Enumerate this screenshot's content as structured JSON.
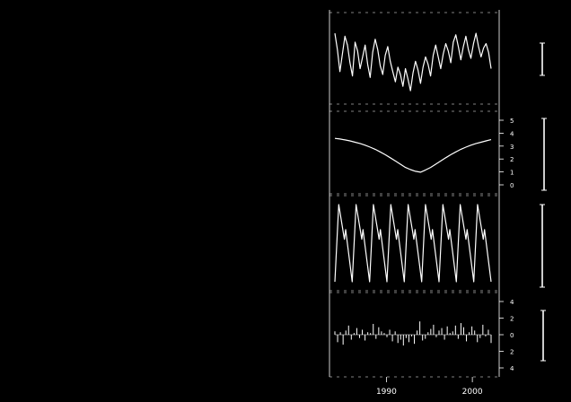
{
  "colors": {
    "background": "#000000",
    "foreground": "#ffffff"
  },
  "chart_data": {
    "type": "line",
    "panels": [
      {
        "kind": "line",
        "y": [
          4.2,
          3.1,
          1.6,
          2.8,
          4.0,
          3.4,
          2.2,
          1.3,
          3.6,
          3.0,
          1.8,
          2.6,
          3.4,
          2.1,
          1.2,
          2.9,
          3.8,
          3.1,
          2.0,
          1.4,
          2.7,
          3.3,
          2.3,
          1.6,
          0.9,
          1.9,
          1.4,
          0.6,
          1.8,
          1.1,
          0.3,
          1.5,
          2.3,
          1.7,
          0.8,
          1.9,
          2.6,
          2.1,
          1.3,
          2.7,
          3.4,
          2.6,
          1.8,
          2.8,
          3.5,
          3.0,
          2.2,
          3.6,
          4.1,
          3.3,
          2.4,
          3.3,
          4.0,
          3.1,
          2.5,
          3.5,
          4.2,
          3.3,
          2.6,
          3.2,
          3.5,
          2.9,
          1.8
        ],
        "ylim": [
          0,
          5
        ],
        "yticks": [],
        "ytick_labels": []
      },
      {
        "kind": "line",
        "y": [
          3.6,
          3.55,
          3.48,
          3.4,
          3.3,
          3.2,
          3.07,
          2.92,
          2.75,
          2.55,
          2.33,
          2.1,
          1.85,
          1.6,
          1.35,
          1.18,
          1.05,
          0.98,
          1.15,
          1.35,
          1.6,
          1.85,
          2.1,
          2.33,
          2.55,
          2.75,
          2.92,
          3.07,
          3.2,
          3.3,
          3.4,
          3.5
        ],
        "ylim": [
          0,
          5
        ],
        "yticks": [
          5,
          4,
          3,
          2,
          1,
          0
        ],
        "ytick_labels": [
          "5",
          "4",
          "3",
          "2",
          "1",
          "0"
        ]
      },
      {
        "kind": "seasonal",
        "periods": 9,
        "ylim": [
          -1,
          1
        ],
        "yticks": [],
        "ytick_labels": []
      },
      {
        "kind": "spikes",
        "y": [
          0.4,
          -0.9,
          0.3,
          -1.2,
          0.5,
          1.1,
          -0.6,
          0.2,
          0.8,
          -0.4,
          0.6,
          -0.7,
          0.3,
          0.2,
          1.3,
          -0.5,
          0.9,
          0.4,
          0.2,
          -0.3,
          0.6,
          -0.8,
          0.4,
          -1.0,
          -0.6,
          -1.3,
          -0.4,
          -0.9,
          -0.2,
          -1.1,
          0.5,
          1.6,
          -0.7,
          -0.5,
          0.3,
          0.7,
          1.2,
          -0.3,
          0.5,
          0.8,
          -0.6,
          1.0,
          0.2,
          0.4,
          1.1,
          -0.5,
          1.4,
          0.9,
          -0.8,
          0.3,
          1.0,
          0.5,
          -0.9,
          -0.4,
          1.2,
          -0.2,
          0.6,
          -1.0
        ],
        "ylim": [
          -4,
          4
        ],
        "yticks": [
          4,
          2,
          0,
          -2,
          -4
        ],
        "ytick_labels": [
          "4",
          "2",
          "0",
          "2",
          "4"
        ]
      }
    ],
    "xticks": [
      {
        "frac": 0.33,
        "label": "1990"
      },
      {
        "frac": 0.88,
        "label": "2000"
      }
    ],
    "title": "",
    "xlabel": "",
    "ylabel": ""
  }
}
